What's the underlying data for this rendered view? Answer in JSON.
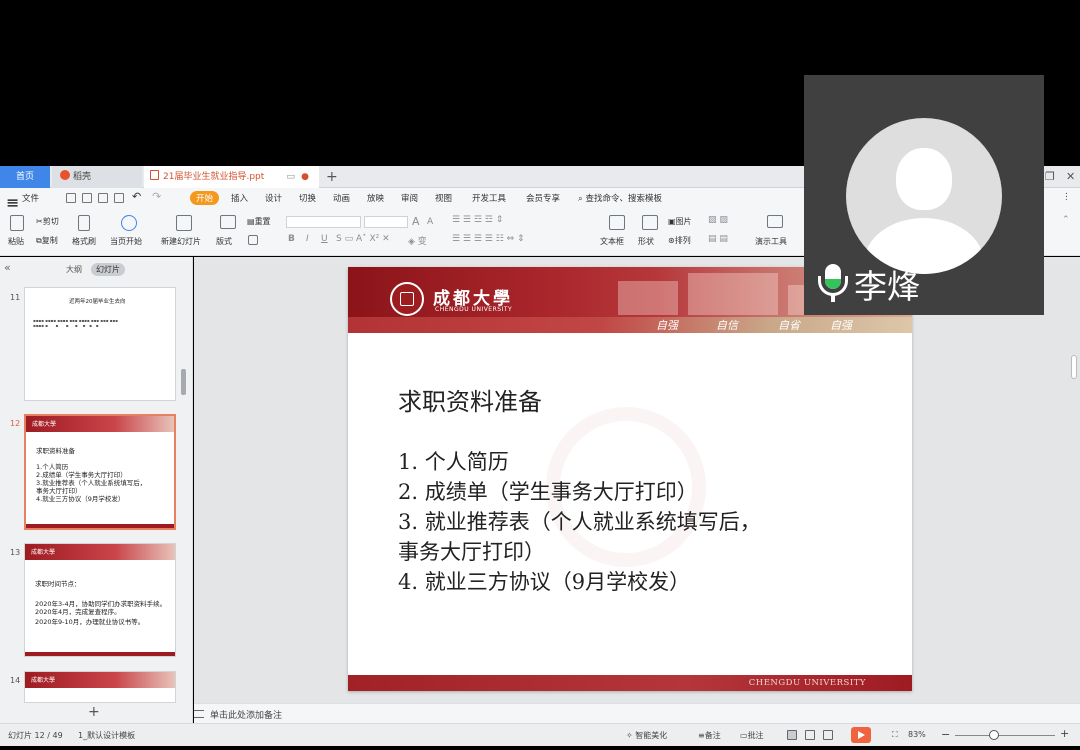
{
  "tabs": {
    "home": "首页",
    "docer": "稻壳",
    "file": "21届毕业生就业指导.ppt",
    "add": "+"
  },
  "menu": {
    "file": "文件",
    "items": [
      "开始",
      "插入",
      "设计",
      "切换",
      "动画",
      "放映",
      "审阅",
      "视图",
      "开发工具",
      "会员专享"
    ],
    "search": "查找命令、搜索模板"
  },
  "ribbon": {
    "paste": "粘贴",
    "cut": "剪切",
    "copy": "复制",
    "format_painter": "格式刷",
    "from_current": "当页开始",
    "new_slide": "新建幻灯片",
    "layout": "版式",
    "reset": "重置",
    "font_size_inc": "A",
    "font_size_dec": "A",
    "bold": "B",
    "italic": "I",
    "underline": "U",
    "text_box": "文本框",
    "shape": "形状",
    "picture": "图片",
    "arrange": "排列",
    "presenter": "演示工具"
  },
  "left_panel": {
    "tab_outline": "大纲",
    "tab_slides": "幻灯片",
    "add": "+",
    "slides": [
      {
        "number": "11",
        "title": "近两年20届毕业生去向"
      },
      {
        "number": "12",
        "title": "求职资料准备",
        "lines": [
          "1.个人简历",
          "2.成绩单（学生事务大厅打印）",
          "3.就业推荐表（个人就业系统填写后，",
          "事务大厅打印）",
          "4.就业三方协议（9月学校发）"
        ]
      },
      {
        "number": "13",
        "title": "求职时间节点：",
        "lines": [
          "2020年3-4月，协助同学们办求职资料手续。",
          "2020年4月，完成复查程序。",
          "2020年9-10月，办理就业协议书等。"
        ]
      },
      {
        "number": "14"
      }
    ]
  },
  "slide": {
    "logo_cn": "成都大學",
    "logo_en": "CHENGDU UNIVERSITY",
    "motto": [
      "自强",
      "自信",
      "自省",
      "自强"
    ],
    "title": "求职资料准备",
    "lines": [
      "1. 个人简历",
      "2. 成绩单（学生事务大厅打印）",
      "3. 就业推荐表（个人就业系统填写后，",
      "事务大厅打印）",
      "4. 就业三方协议（9月学校发）"
    ],
    "footer": "CHENGDU UNIVERSITY"
  },
  "notes": {
    "placeholder": "单击此处添加备注"
  },
  "status": {
    "slide_counter": "幻灯片 12 / 49",
    "template": "1_默认设计模板",
    "smart_beautify": "智能美化",
    "notes": "备注",
    "comments": "批注",
    "zoom": "83%",
    "zoom_minus": "−",
    "zoom_plus": "+"
  },
  "video": {
    "name": "李烽"
  }
}
